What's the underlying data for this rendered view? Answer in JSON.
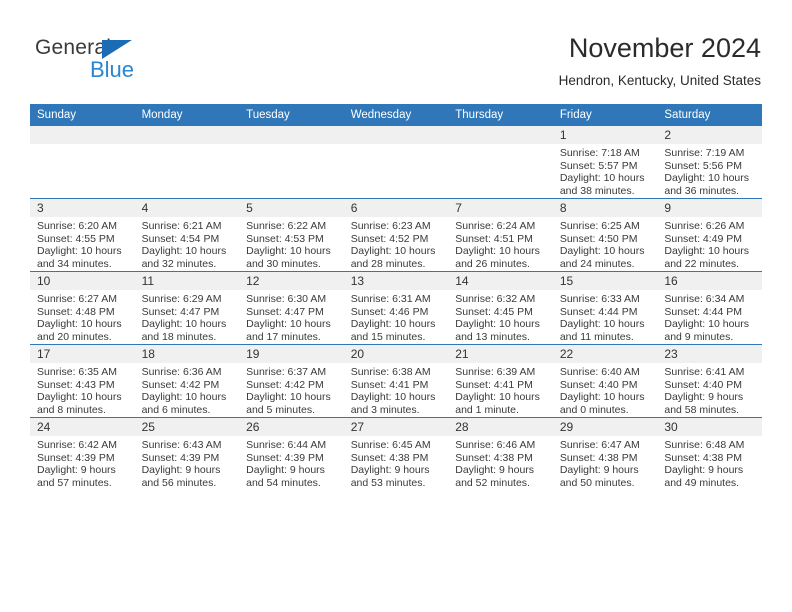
{
  "brand": {
    "name_part1": "General",
    "name_part2": "Blue",
    "triangle_color": "#1b6cb5",
    "blue_color": "#2a86d0"
  },
  "header": {
    "title": "November 2024",
    "location": "Hendron, Kentucky, United States",
    "accent_color": "#2f77b8"
  },
  "calendar": {
    "weekdays": [
      "Sunday",
      "Monday",
      "Tuesday",
      "Wednesday",
      "Thursday",
      "Friday",
      "Saturday"
    ],
    "weeks": [
      [
        {
          "day": "",
          "empty": true
        },
        {
          "day": "",
          "empty": true
        },
        {
          "day": "",
          "empty": true
        },
        {
          "day": "",
          "empty": true
        },
        {
          "day": "",
          "empty": true
        },
        {
          "day": "1",
          "sunrise": "Sunrise: 7:18 AM",
          "sunset": "Sunset: 5:57 PM",
          "daylight": "Daylight: 10 hours and 38 minutes."
        },
        {
          "day": "2",
          "sunrise": "Sunrise: 7:19 AM",
          "sunset": "Sunset: 5:56 PM",
          "daylight": "Daylight: 10 hours and 36 minutes."
        }
      ],
      [
        {
          "day": "3",
          "sunrise": "Sunrise: 6:20 AM",
          "sunset": "Sunset: 4:55 PM",
          "daylight": "Daylight: 10 hours and 34 minutes."
        },
        {
          "day": "4",
          "sunrise": "Sunrise: 6:21 AM",
          "sunset": "Sunset: 4:54 PM",
          "daylight": "Daylight: 10 hours and 32 minutes."
        },
        {
          "day": "5",
          "sunrise": "Sunrise: 6:22 AM",
          "sunset": "Sunset: 4:53 PM",
          "daylight": "Daylight: 10 hours and 30 minutes."
        },
        {
          "day": "6",
          "sunrise": "Sunrise: 6:23 AM",
          "sunset": "Sunset: 4:52 PM",
          "daylight": "Daylight: 10 hours and 28 minutes."
        },
        {
          "day": "7",
          "sunrise": "Sunrise: 6:24 AM",
          "sunset": "Sunset: 4:51 PM",
          "daylight": "Daylight: 10 hours and 26 minutes."
        },
        {
          "day": "8",
          "sunrise": "Sunrise: 6:25 AM",
          "sunset": "Sunset: 4:50 PM",
          "daylight": "Daylight: 10 hours and 24 minutes."
        },
        {
          "day": "9",
          "sunrise": "Sunrise: 6:26 AM",
          "sunset": "Sunset: 4:49 PM",
          "daylight": "Daylight: 10 hours and 22 minutes."
        }
      ],
      [
        {
          "day": "10",
          "sunrise": "Sunrise: 6:27 AM",
          "sunset": "Sunset: 4:48 PM",
          "daylight": "Daylight: 10 hours and 20 minutes."
        },
        {
          "day": "11",
          "sunrise": "Sunrise: 6:29 AM",
          "sunset": "Sunset: 4:47 PM",
          "daylight": "Daylight: 10 hours and 18 minutes."
        },
        {
          "day": "12",
          "sunrise": "Sunrise: 6:30 AM",
          "sunset": "Sunset: 4:47 PM",
          "daylight": "Daylight: 10 hours and 17 minutes."
        },
        {
          "day": "13",
          "sunrise": "Sunrise: 6:31 AM",
          "sunset": "Sunset: 4:46 PM",
          "daylight": "Daylight: 10 hours and 15 minutes."
        },
        {
          "day": "14",
          "sunrise": "Sunrise: 6:32 AM",
          "sunset": "Sunset: 4:45 PM",
          "daylight": "Daylight: 10 hours and 13 minutes."
        },
        {
          "day": "15",
          "sunrise": "Sunrise: 6:33 AM",
          "sunset": "Sunset: 4:44 PM",
          "daylight": "Daylight: 10 hours and 11 minutes."
        },
        {
          "day": "16",
          "sunrise": "Sunrise: 6:34 AM",
          "sunset": "Sunset: 4:44 PM",
          "daylight": "Daylight: 10 hours and 9 minutes."
        }
      ],
      [
        {
          "day": "17",
          "sunrise": "Sunrise: 6:35 AM",
          "sunset": "Sunset: 4:43 PM",
          "daylight": "Daylight: 10 hours and 8 minutes."
        },
        {
          "day": "18",
          "sunrise": "Sunrise: 6:36 AM",
          "sunset": "Sunset: 4:42 PM",
          "daylight": "Daylight: 10 hours and 6 minutes."
        },
        {
          "day": "19",
          "sunrise": "Sunrise: 6:37 AM",
          "sunset": "Sunset: 4:42 PM",
          "daylight": "Daylight: 10 hours and 5 minutes."
        },
        {
          "day": "20",
          "sunrise": "Sunrise: 6:38 AM",
          "sunset": "Sunset: 4:41 PM",
          "daylight": "Daylight: 10 hours and 3 minutes."
        },
        {
          "day": "21",
          "sunrise": "Sunrise: 6:39 AM",
          "sunset": "Sunset: 4:41 PM",
          "daylight": "Daylight: 10 hours and 1 minute."
        },
        {
          "day": "22",
          "sunrise": "Sunrise: 6:40 AM",
          "sunset": "Sunset: 4:40 PM",
          "daylight": "Daylight: 10 hours and 0 minutes."
        },
        {
          "day": "23",
          "sunrise": "Sunrise: 6:41 AM",
          "sunset": "Sunset: 4:40 PM",
          "daylight": "Daylight: 9 hours and 58 minutes."
        }
      ],
      [
        {
          "day": "24",
          "sunrise": "Sunrise: 6:42 AM",
          "sunset": "Sunset: 4:39 PM",
          "daylight": "Daylight: 9 hours and 57 minutes."
        },
        {
          "day": "25",
          "sunrise": "Sunrise: 6:43 AM",
          "sunset": "Sunset: 4:39 PM",
          "daylight": "Daylight: 9 hours and 56 minutes."
        },
        {
          "day": "26",
          "sunrise": "Sunrise: 6:44 AM",
          "sunset": "Sunset: 4:39 PM",
          "daylight": "Daylight: 9 hours and 54 minutes."
        },
        {
          "day": "27",
          "sunrise": "Sunrise: 6:45 AM",
          "sunset": "Sunset: 4:38 PM",
          "daylight": "Daylight: 9 hours and 53 minutes."
        },
        {
          "day": "28",
          "sunrise": "Sunrise: 6:46 AM",
          "sunset": "Sunset: 4:38 PM",
          "daylight": "Daylight: 9 hours and 52 minutes."
        },
        {
          "day": "29",
          "sunrise": "Sunrise: 6:47 AM",
          "sunset": "Sunset: 4:38 PM",
          "daylight": "Daylight: 9 hours and 50 minutes."
        },
        {
          "day": "30",
          "sunrise": "Sunrise: 6:48 AM",
          "sunset": "Sunset: 4:38 PM",
          "daylight": "Daylight: 9 hours and 49 minutes."
        }
      ]
    ]
  }
}
